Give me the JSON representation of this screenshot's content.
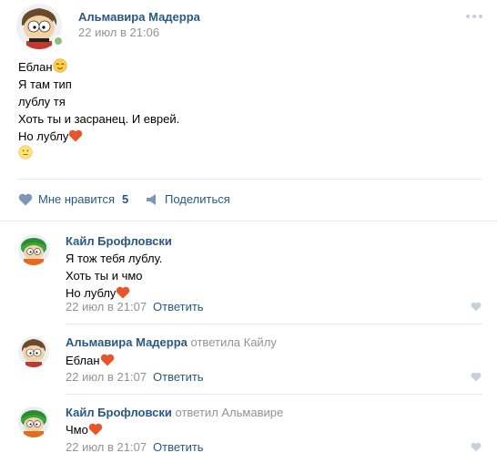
{
  "post": {
    "author": "Альмавира Мадерра",
    "date": "22 июл в 21:06",
    "lines": [
      "Еблан",
      "Я там тип",
      "лублу тя",
      "Хоть ты и засранец. И еврей.",
      "Но лублу"
    ],
    "likes_label": "Мне нравится",
    "likes_count": "5",
    "share_label": "Поделиться"
  },
  "comments": [
    {
      "author": "Кайл Брофловски",
      "lines": [
        "Я тож тебя лублу.",
        "Хоть ты и чмо",
        "Но лублу"
      ],
      "date": "22 июл в 21:07",
      "reply_label": "Ответить"
    },
    {
      "author": "Альмавира Мадерра",
      "replied_to": "ответила Кайлу",
      "lines": [
        "Еблан"
      ],
      "date": "22 июл в 21:07",
      "reply_label": "Ответить"
    },
    {
      "author": "Кайл Брофловски",
      "replied_to": "ответил Альмавире",
      "lines": [
        "Чмо"
      ],
      "date": "22 июл в 21:07",
      "reply_label": "Ответить"
    }
  ],
  "colors": {
    "link": "#2a5885",
    "muted": "#939393",
    "heart": "#e8552a",
    "icon": "#7b96b8",
    "divider": "#e7e8ec"
  },
  "icons": [
    "more-icon",
    "relieved-emoji-icon",
    "heart-emoji-icon",
    "slight-smile-emoji-icon",
    "like-icon",
    "share-icon",
    "comment-like-icon"
  ]
}
